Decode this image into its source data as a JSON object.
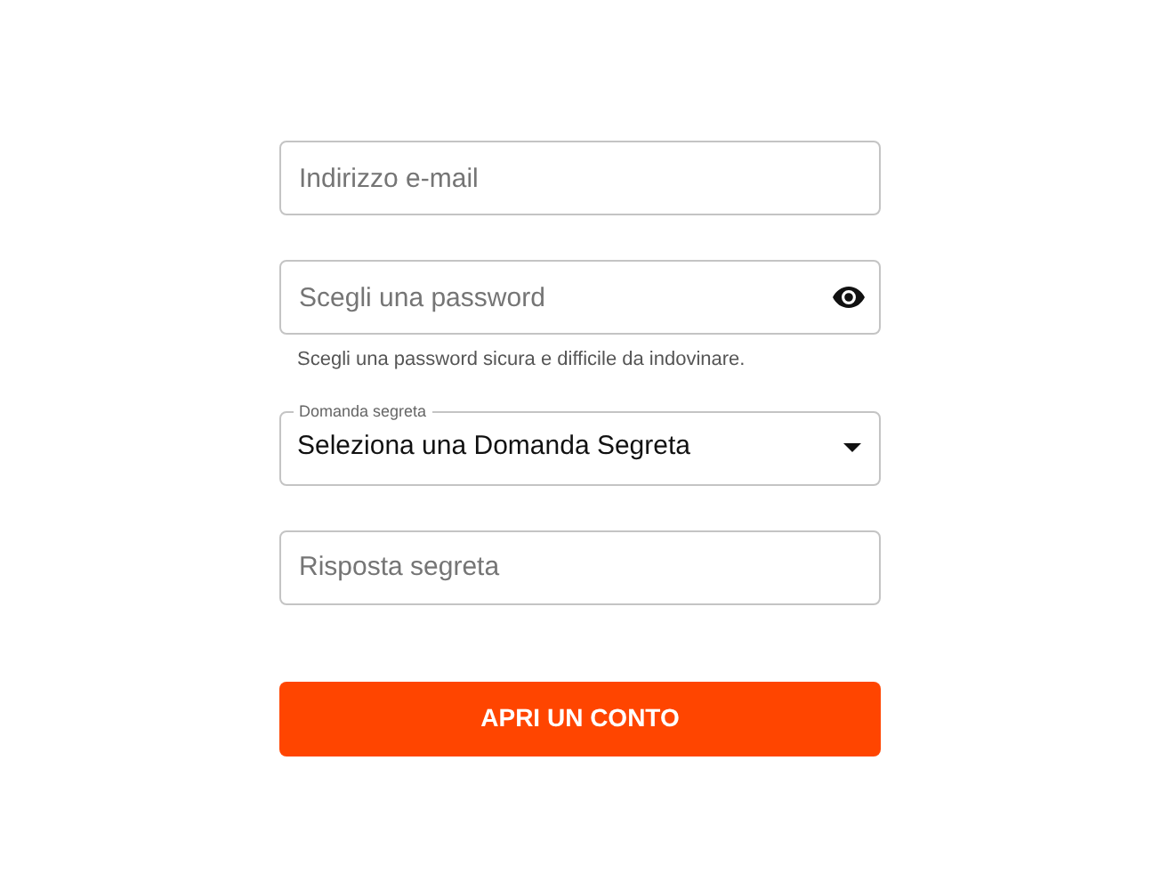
{
  "fields": [
    {
      "kind": "text",
      "placeholder": "Indirizzo e-mail"
    },
    {
      "kind": "password",
      "placeholder": "Scegli una password",
      "helper": "Scegli una password sicura e difficile da indovinare."
    },
    {
      "kind": "select",
      "label": "Domanda segreta",
      "value": "Seleziona una Domanda Segreta"
    },
    {
      "kind": "text",
      "placeholder": "Risposta segreta"
    }
  ],
  "submit": {
    "label": "APRI UN CONTO"
  }
}
